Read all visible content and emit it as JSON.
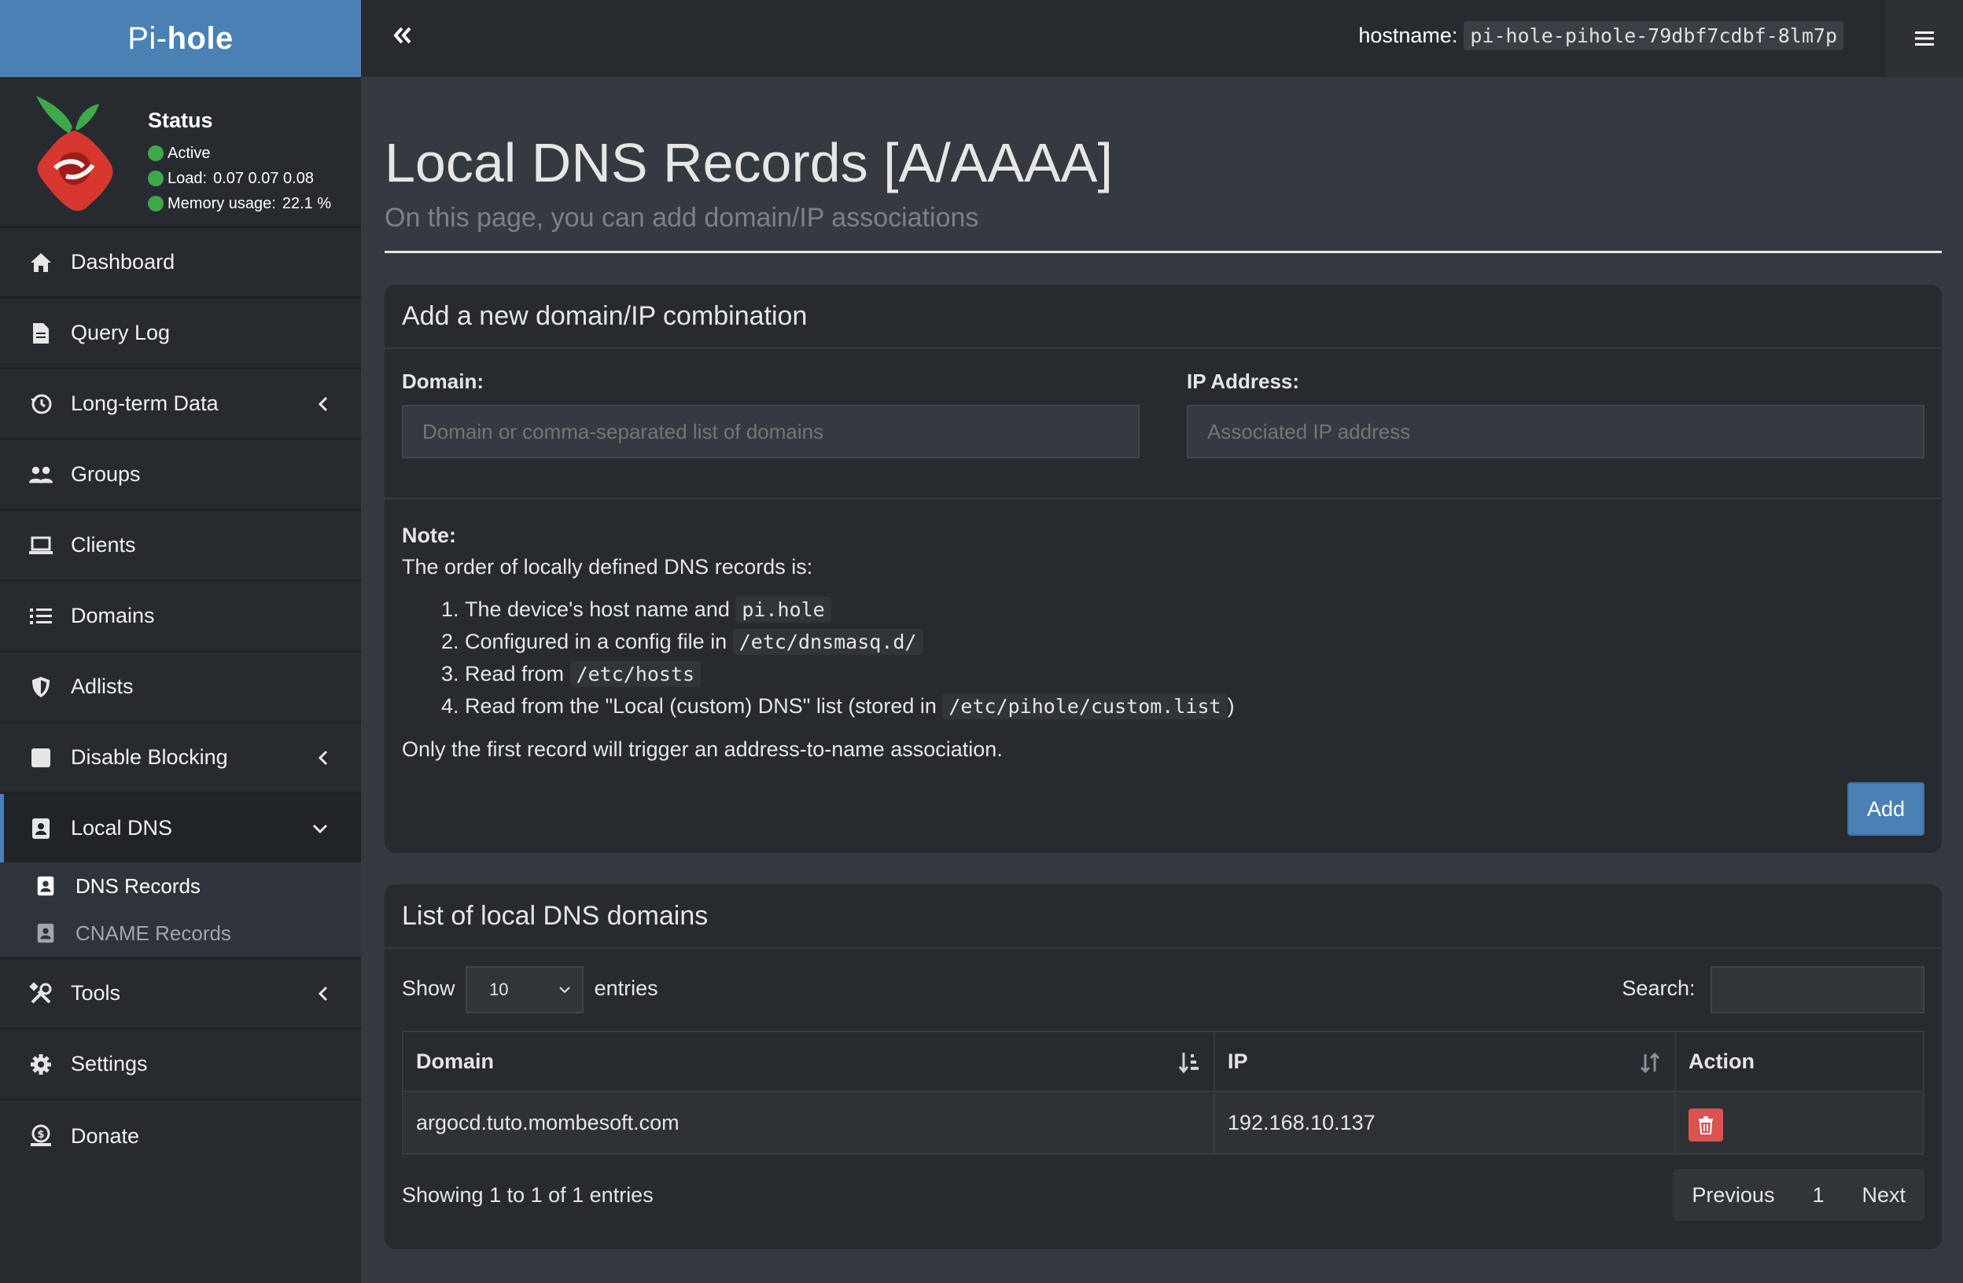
{
  "brand": {
    "prefix": "Pi-",
    "bold": "hole"
  },
  "status": {
    "title": "Status",
    "active": "Active",
    "load_label": "Load:",
    "load_value": "0.07  0.07  0.08",
    "memory_label": "Memory usage:",
    "memory_value": "22.1 %",
    "indicator_color": "#3ea84a"
  },
  "topbar": {
    "hostname_label": "hostname:",
    "hostname_value": "pi-hole-pihole-79dbf7cdbf-8lm7p"
  },
  "sidebar": {
    "items": [
      {
        "label": "Dashboard",
        "icon": "home-icon"
      },
      {
        "label": "Query Log",
        "icon": "file-icon"
      },
      {
        "label": "Long-term Data",
        "icon": "history-icon"
      },
      {
        "label": "Groups",
        "icon": "users-icon"
      },
      {
        "label": "Clients",
        "icon": "laptop-icon"
      },
      {
        "label": "Domains",
        "icon": "list-icon"
      },
      {
        "label": "Adlists",
        "icon": "shield-icon"
      },
      {
        "label": "Disable Blocking",
        "icon": "stop-icon"
      },
      {
        "label": "Local DNS",
        "icon": "address-book-icon"
      },
      {
        "label": "Tools",
        "icon": "tools-icon"
      },
      {
        "label": "Settings",
        "icon": "gear-icon"
      },
      {
        "label": "Donate",
        "icon": "donate-icon"
      }
    ],
    "sub": [
      {
        "label": "DNS Records"
      },
      {
        "label": "CNAME Records"
      }
    ]
  },
  "page": {
    "title": "Local DNS Records [A/AAAA]",
    "subtitle": "On this page, you can add domain/IP associations"
  },
  "add_card": {
    "title": "Add a new domain/IP combination",
    "domain_label": "Domain:",
    "domain_placeholder": "Domain or comma-separated list of domains",
    "ip_label": "IP Address:",
    "ip_placeholder": "Associated IP address",
    "note_title": "Note:",
    "note_intro": "The order of locally defined DNS records is:",
    "steps": [
      {
        "text": "The device's host name and ",
        "code": "pi.hole",
        "after": ""
      },
      {
        "text": "Configured in a config file in ",
        "code": "/etc/dnsmasq.d/",
        "after": ""
      },
      {
        "text": "Read from ",
        "code": "/etc/hosts",
        "after": ""
      },
      {
        "text": "Read from the \"Local (custom) DNS\" list (stored in ",
        "code": "/etc/pihole/custom.list",
        "after": ")"
      }
    ],
    "note_outro": "Only the first record will trigger an address-to-name association.",
    "add_button": "Add"
  },
  "list_card": {
    "title": "List of local DNS domains",
    "show_label": "Show",
    "entries_value": "10",
    "entries_label": "entries",
    "search_label": "Search:",
    "columns": [
      "Domain",
      "IP",
      "Action"
    ],
    "rows": [
      {
        "domain": "argocd.tuto.mombesoft.com",
        "ip": "192.168.10.137"
      }
    ],
    "info": "Showing 1 to 1 of 1 entries",
    "pagination": {
      "prev": "Previous",
      "page": "1",
      "next": "Next"
    }
  },
  "colors": {
    "accent": "#4a81b4",
    "danger": "#d9534f",
    "background": "#353a40",
    "sidebar": "#272b30"
  }
}
